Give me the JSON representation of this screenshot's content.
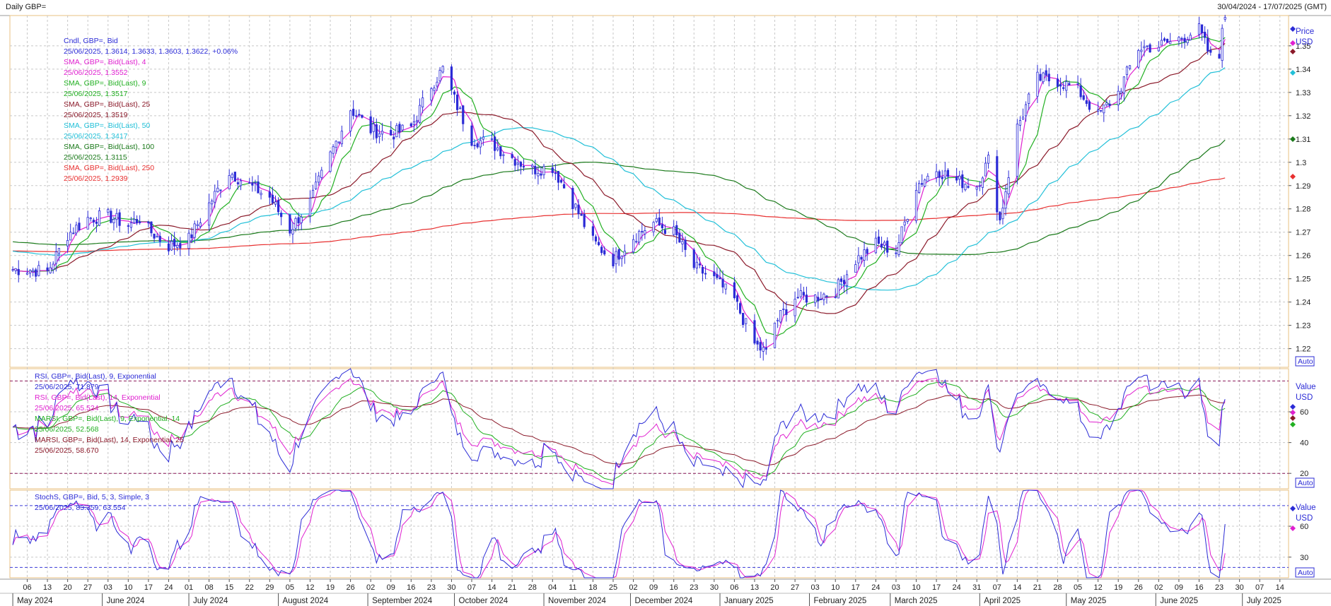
{
  "header": {
    "title": "Daily GBP=",
    "range": "30/04/2024 - 17/07/2025 (GMT)"
  },
  "colors": {
    "candle": "#2b2bd6",
    "sma4": "#e020d0",
    "sma9": "#22b022",
    "sma25": "#8b1a2a",
    "sma50": "#22c0d8",
    "sma100": "#1b7a1b",
    "sma250": "#e83030",
    "rsi9": "#2b2bd6",
    "rsi14": "#e020d0",
    "marsi9": "#22b022",
    "marsi14": "#8b1a2a",
    "stochK": "#2b2bd6",
    "stochD": "#e020d0",
    "grid": "#c8c8c8",
    "frame": "#e8c080"
  },
  "price_pane": {
    "legend": [
      {
        "name": "Cndl, GBP=, Bid",
        "value": "25/06/2025, 1.3614, 1.3633, 1.3603, 1.3622, +0.06%",
        "color": "#2b2bd6"
      },
      {
        "name": "SMA, GBP=, Bid(Last), 4",
        "value": "25/06/2025, 1.3552",
        "color": "#e020d0"
      },
      {
        "name": "SMA, GBP=, Bid(Last), 9",
        "value": "25/06/2025, 1.3517",
        "color": "#22b022"
      },
      {
        "name": "SMA, GBP=, Bid(Last), 25",
        "value": "25/06/2025, 1.3519",
        "color": "#8b1a2a"
      },
      {
        "name": "SMA, GBP=, Bid(Last), 50",
        "value": "25/06/2025, 1.3417",
        "color": "#22c0d8"
      },
      {
        "name": "SMA, GBP=, Bid(Last), 100",
        "value": "25/06/2025, 1.3115",
        "color": "#1b7a1b"
      },
      {
        "name": "SMA, GBP=, Bid(Last), 250",
        "value": "25/06/2025, 1.2939",
        "color": "#e83030"
      }
    ],
    "axis_title": "Price",
    "axis_unit": "USD",
    "auto_label": "Auto"
  },
  "rsi_pane": {
    "legend": [
      {
        "name": "RSI, GBP=, Bid(Last), 9, Exponential",
        "value": "25/06/2025, 71.879",
        "color": "#2b2bd6"
      },
      {
        "name": "RSI, GBP=, Bid(Last), 14, Exponential",
        "value": "25/06/2025, 65.524",
        "color": "#e020d0"
      },
      {
        "name": "MARSI, GBP=, Bid(Last), 9, Exponential, 14",
        "value": "25/06/2025, 52.568",
        "color": "#22b022"
      },
      {
        "name": "MARSI, GBP=, Bid(Last), 14, Exponential, 25",
        "value": "25/06/2025, 58.670",
        "color": "#8b1a2a"
      }
    ],
    "axis_title": "Value",
    "axis_unit": "USD",
    "auto_label": "Auto"
  },
  "stoch_pane": {
    "legend": [
      {
        "name": "StochS, GBP=, Bid, 5, 3, Simple, 3",
        "value": "25/06/2025, 83.359, 63.554",
        "color": "#2b2bd6"
      }
    ],
    "axis_title": "Value",
    "axis_unit": "USD",
    "auto_label": "Auto"
  },
  "x_axis": {
    "day_ticks": [
      "06",
      "13",
      "20",
      "27",
      "03",
      "10",
      "17",
      "24",
      "01",
      "08",
      "15",
      "22",
      "29",
      "05",
      "12",
      "19",
      "26",
      "02",
      "09",
      "16",
      "23",
      "30",
      "07",
      "14",
      "21",
      "28",
      "04",
      "11",
      "18",
      "25",
      "02",
      "09",
      "16",
      "23",
      "30",
      "06",
      "13",
      "20",
      "27",
      "03",
      "10",
      "17",
      "24",
      "03",
      "10",
      "17",
      "24",
      "31",
      "07",
      "14",
      "21",
      "28",
      "05",
      "12",
      "19",
      "26",
      "02",
      "09",
      "16",
      "23",
      "30",
      "07",
      "14"
    ],
    "months": [
      "May 2024",
      "June 2024",
      "July 2024",
      "August 2024",
      "September 2024",
      "October 2024",
      "November 2024",
      "December 2024",
      "January 2025",
      "February 2025",
      "March 2025",
      "April 2025",
      "May 2025",
      "June 2025",
      "July 2025"
    ]
  },
  "chart_data": [
    {
      "type": "candlestick",
      "title": "Daily GBP=",
      "unit": "USD",
      "ylim": [
        1.212,
        1.363
      ],
      "y_ticks": [
        1.22,
        1.23,
        1.24,
        1.25,
        1.26,
        1.27,
        1.28,
        1.29,
        1.3,
        1.31,
        1.32,
        1.33,
        1.34,
        1.35
      ],
      "x_range": [
        "2024-04-30",
        "2025-07-17"
      ],
      "grid": true,
      "close_anchors": [
        [
          "2024-05-06",
          1.254
        ],
        [
          "2024-05-13",
          1.253
        ],
        [
          "2024-05-20",
          1.269
        ],
        [
          "2024-05-27",
          1.276
        ],
        [
          "2024-06-03",
          1.277
        ],
        [
          "2024-06-10",
          1.273
        ],
        [
          "2024-06-14",
          1.276
        ],
        [
          "2024-06-17",
          1.271
        ],
        [
          "2024-06-24",
          1.264
        ],
        [
          "2024-07-01",
          1.267
        ],
        [
          "2024-07-08",
          1.282
        ],
        [
          "2024-07-15",
          1.296
        ],
        [
          "2024-07-22",
          1.29
        ],
        [
          "2024-07-29",
          1.285
        ],
        [
          "2024-08-05",
          1.271
        ],
        [
          "2024-08-12",
          1.283
        ],
        [
          "2024-08-19",
          1.303
        ],
        [
          "2024-08-26",
          1.323
        ],
        [
          "2024-09-02",
          1.314
        ],
        [
          "2024-09-09",
          1.312
        ],
        [
          "2024-09-16",
          1.315
        ],
        [
          "2024-09-23",
          1.333
        ],
        [
          "2024-09-27",
          1.34
        ],
        [
          "2024-10-01",
          1.327
        ],
        [
          "2024-10-07",
          1.31
        ],
        [
          "2024-10-14",
          1.308
        ],
        [
          "2024-10-21",
          1.302
        ],
        [
          "2024-10-28",
          1.297
        ],
        [
          "2024-11-04",
          1.298
        ],
        [
          "2024-11-11",
          1.283
        ],
        [
          "2024-11-18",
          1.266
        ],
        [
          "2024-11-25",
          1.258
        ],
        [
          "2024-12-02",
          1.268
        ],
        [
          "2024-12-09",
          1.274
        ],
        [
          "2024-12-16",
          1.27
        ],
        [
          "2024-12-23",
          1.255
        ],
        [
          "2024-12-30",
          1.25
        ],
        [
          "2025-01-06",
          1.241
        ],
        [
          "2025-01-13",
          1.222
        ],
        [
          "2025-01-17",
          1.218
        ],
        [
          "2025-01-20",
          1.231
        ],
        [
          "2025-01-27",
          1.242
        ],
        [
          "2025-02-03",
          1.242
        ],
        [
          "2025-02-10",
          1.245
        ],
        [
          "2025-02-17",
          1.258
        ],
        [
          "2025-02-24",
          1.265
        ],
        [
          "2025-03-03",
          1.262
        ],
        [
          "2025-03-10",
          1.29
        ],
        [
          "2025-03-17",
          1.297
        ],
        [
          "2025-03-24",
          1.292
        ],
        [
          "2025-03-31",
          1.29
        ],
        [
          "2025-04-04",
          1.301
        ],
        [
          "2025-04-08",
          1.275
        ],
        [
          "2025-04-14",
          1.315
        ],
        [
          "2025-04-21",
          1.336
        ],
        [
          "2025-04-28",
          1.335
        ],
        [
          "2025-05-05",
          1.331
        ],
        [
          "2025-05-12",
          1.32
        ],
        [
          "2025-05-19",
          1.33
        ],
        [
          "2025-05-26",
          1.349
        ],
        [
          "2025-06-02",
          1.35
        ],
        [
          "2025-06-09",
          1.353
        ],
        [
          "2025-06-16",
          1.357
        ],
        [
          "2025-06-20",
          1.345
        ],
        [
          "2025-06-23",
          1.345
        ],
        [
          "2025-06-24",
          1.36
        ],
        [
          "2025-06-25",
          1.362
        ]
      ],
      "last_candle": {
        "date": "2025-06-25",
        "open": 1.3614,
        "high": 1.3633,
        "low": 1.3603,
        "close": 1.3622
      },
      "series_last_values": {
        "SMA 4": 1.3552,
        "SMA 9": 1.3517,
        "SMA 25": 1.3519,
        "SMA 50": 1.3417,
        "SMA 100": 1.3115,
        "SMA 250": 1.2939
      }
    },
    {
      "type": "line",
      "title": "RSI / MARSI",
      "ylim": [
        10,
        88
      ],
      "y_ticks": [
        20,
        40,
        60
      ],
      "reference_lines": [
        20,
        80
      ],
      "series_last_values": {
        "RSI 9": 71.879,
        "RSI 14": 65.524,
        "MARSI 9": 52.568,
        "MARSI 14": 58.67
      }
    },
    {
      "type": "line",
      "title": "StochS",
      "ylim": [
        10,
        95
      ],
      "y_ticks": [
        30,
        60
      ],
      "reference_lines": [
        20,
        80
      ],
      "series_last_values": {
        "%K": 83.359,
        "%D": 63.554
      }
    }
  ]
}
